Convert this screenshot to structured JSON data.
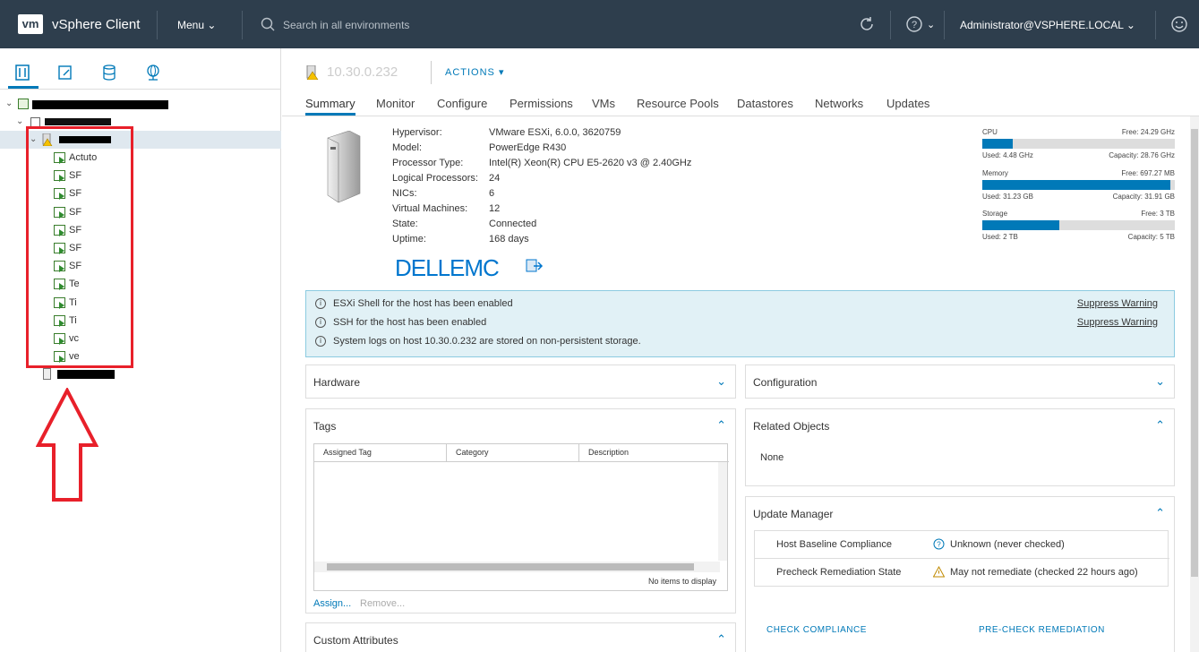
{
  "header": {
    "logo": "vm",
    "app_name": "vSphere Client",
    "menu_label": "Menu",
    "search_placeholder": "Search in all environments",
    "user": "Administrator@VSPHERE.LOCAL"
  },
  "tree": {
    "items": [
      {
        "label": "Actuto"
      },
      {
        "label": "SF"
      },
      {
        "label": "SF"
      },
      {
        "label": "SF"
      },
      {
        "label": "SF"
      },
      {
        "label": "SF"
      },
      {
        "label": "SF"
      },
      {
        "label": "Te"
      },
      {
        "label": "Ti"
      },
      {
        "label": "Ti"
      },
      {
        "label": "vc"
      },
      {
        "label": "ve"
      }
    ]
  },
  "main": {
    "host_title": "10.30.0.232",
    "actions_label": "ACTIONS",
    "tabs": [
      "Summary",
      "Monitor",
      "Configure",
      "Permissions",
      "VMs",
      "Resource Pools",
      "Datastores",
      "Networks",
      "Updates"
    ],
    "properties": [
      {
        "label": "Hypervisor:",
        "value": "VMware ESXi, 6.0.0, 3620759"
      },
      {
        "label": "Model:",
        "value": "PowerEdge R430"
      },
      {
        "label": "Processor Type:",
        "value": "Intel(R) Xeon(R) CPU E5-2620 v3 @ 2.40GHz"
      },
      {
        "label": "Logical Processors:",
        "value": "24"
      },
      {
        "label": "NICs:",
        "value": "6"
      },
      {
        "label": "Virtual Machines:",
        "value": "12"
      },
      {
        "label": "State:",
        "value": "Connected"
      },
      {
        "label": "Uptime:",
        "value": "168 days"
      }
    ],
    "vendor_logo": "DELLEMC",
    "resources": [
      {
        "name": "CPU",
        "free": "Free: 24.29 GHz",
        "used": "Used: 4.48 GHz",
        "capacity": "Capacity: 28.76 GHz",
        "fraction": 0.156
      },
      {
        "name": "Memory",
        "free": "Free: 697.27 MB",
        "used": "Used: 31.23 GB",
        "capacity": "Capacity: 31.91 GB",
        "fraction": 0.979
      },
      {
        "name": "Storage",
        "free": "Free: 3 TB",
        "used": "Used: 2 TB",
        "capacity": "Capacity: 5 TB",
        "fraction": 0.4
      }
    ],
    "alerts": [
      {
        "text": "ESXi Shell for the host has been enabled",
        "action": "Suppress Warning"
      },
      {
        "text": "SSH for the host has been enabled",
        "action": "Suppress Warning"
      },
      {
        "text": "System logs on host 10.30.0.232 are stored on non-persistent storage.",
        "action": ""
      }
    ],
    "panels": {
      "hardware": "Hardware",
      "configuration": "Configuration",
      "tags": "Tags",
      "related_objects": "Related Objects",
      "related_none": "None",
      "update_manager": "Update Manager",
      "custom_attributes": "Custom Attributes"
    },
    "tags_grid": {
      "columns": [
        "Assigned Tag",
        "Category",
        "Description"
      ],
      "footer": "No items to display",
      "assign": "Assign...",
      "remove": "Remove..."
    },
    "update_manager": {
      "rows": [
        {
          "key": "Host Baseline Compliance",
          "value": "Unknown (never checked)"
        },
        {
          "key": "Precheck Remediation State",
          "value": "May not remediate (checked 22 hours ago)"
        }
      ],
      "check_compliance": "CHECK COMPLIANCE",
      "precheck": "PRE-CHECK REMEDIATION"
    }
  }
}
